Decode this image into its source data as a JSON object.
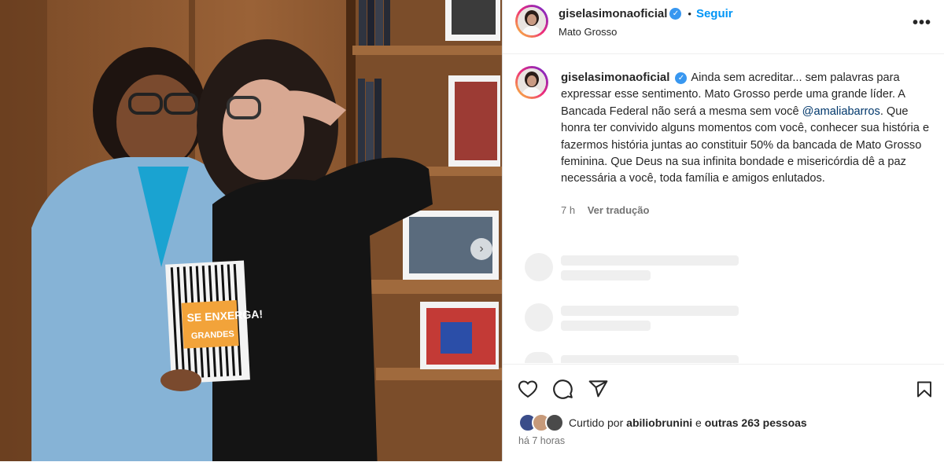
{
  "post": {
    "username": "giselasimonaoficial",
    "follow_label": "Seguir",
    "location": "Mato Grosso",
    "caption_before_mention": "Ainda sem acreditar... sem palavras para expressar esse sentimento. Mato Grosso perde uma grande líder. A Bancada Federal não será a mesma sem você",
    "mention": "@amaliabarros",
    "caption_after_mention": ". Que honra ter convivido alguns momentos com você, conhecer sua história e fazermos história juntas ao constituir 50% da bancada de Mato Grosso feminina. Que Deus na sua infinita bondade e misericórdia dê a paz necessária a você, toda família e amigos enlutados.",
    "caption_age": "7 h",
    "translate_label": "Ver tradução",
    "liked_by_prefix": "Curtido por",
    "liked_by_user": "abiliobrunini",
    "liked_by_connector": "e",
    "liked_by_others": "outras 263 pessoas",
    "posted_ago": "há 7 horas"
  },
  "photo": {
    "book_line1": "SE ENXERGA!",
    "book_line2": "GRANDES"
  },
  "icons": [
    "verified-icon",
    "more-options-icon",
    "like-icon",
    "comment-icon",
    "share-icon",
    "save-icon",
    "next-photo-icon"
  ],
  "colors": {
    "link": "#0095f6",
    "mention": "#00376b",
    "verified": "#3897f0",
    "muted": "#737373"
  }
}
